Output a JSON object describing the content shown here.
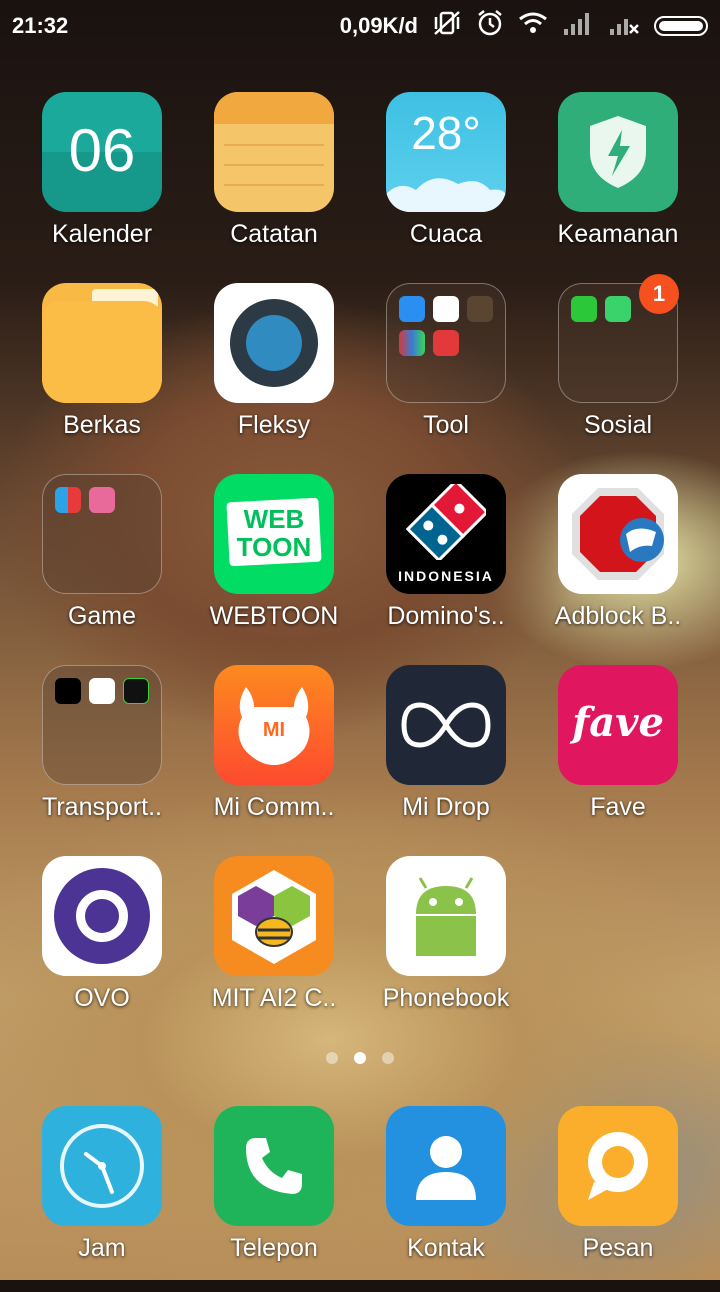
{
  "status_bar": {
    "time": "21:32",
    "net_speed": "0,09K/d",
    "icons": [
      "mute-vibrate-icon",
      "alarm-icon",
      "wifi-icon",
      "signal-icon",
      "signal-no-sim-icon",
      "battery-icon"
    ],
    "battery_level": 0.9
  },
  "apps": [
    {
      "label": "Kalender",
      "icon_text": "06"
    },
    {
      "label": "Catatan"
    },
    {
      "label": "Cuaca",
      "icon_text": "28°"
    },
    {
      "label": "Keamanan"
    },
    {
      "label": "Berkas"
    },
    {
      "label": "Fleksy"
    },
    {
      "label": "Tool"
    },
    {
      "label": "Sosial",
      "badge": "1"
    },
    {
      "label": "Game"
    },
    {
      "label": "WEBTOON",
      "icon_text_1": "WEB",
      "icon_text_2": "TOON"
    },
    {
      "label": "Domino's..",
      "icon_text": "INDONESIA"
    },
    {
      "label": "Adblock B.."
    },
    {
      "label": "Transport.."
    },
    {
      "label": "Mi Comm..",
      "icon_text": "MI"
    },
    {
      "label": "Mi Drop"
    },
    {
      "label": "Fave",
      "icon_text": "fave"
    },
    {
      "label": "OVO"
    },
    {
      "label": "MIT AI2 C.."
    },
    {
      "label": "Phonebook"
    }
  ],
  "page_indicator": {
    "pages": 3,
    "active": 1
  },
  "dock": [
    {
      "label": "Jam"
    },
    {
      "label": "Telepon"
    },
    {
      "label": "Kontak"
    },
    {
      "label": "Pesan"
    }
  ],
  "colors": {
    "kalender": "#1ba99c",
    "catatan": "#f5c56a",
    "cuaca": "#3ec0e3",
    "keamanan": "#2fae7a",
    "berkas": "#f9b945",
    "webtoon": "#00dc64",
    "fave": "#e0175f",
    "mi_comm": "#fd6a1f",
    "mi_drop": "#202838",
    "ovo": "#4c3494",
    "mit": "#f68b1f",
    "jam": "#2eb1dc",
    "telepon": "#1fb45a",
    "kontak": "#2491e0",
    "pesan": "#fbae2c",
    "badge": "#f5501e"
  }
}
